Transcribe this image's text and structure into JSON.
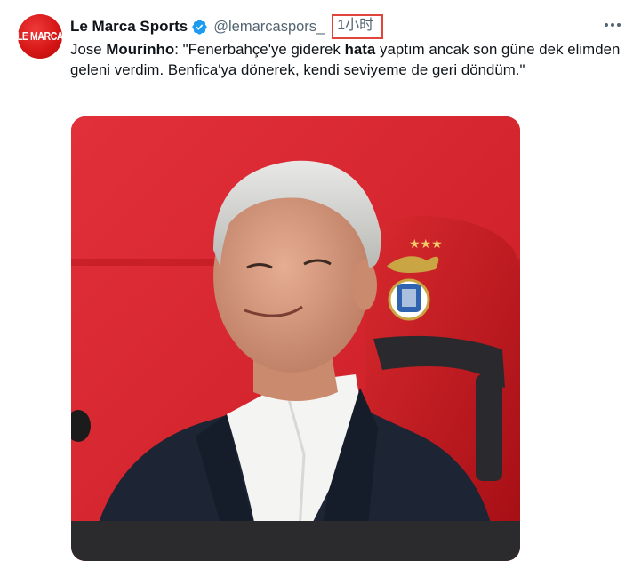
{
  "account": {
    "avatar_text": "LE MARCA",
    "display_name": "Le Marca Sports",
    "handle": "@lemarcaspors_",
    "time": "1小时",
    "verified_icon": "verified-badge-icon"
  },
  "tweet": {
    "text_parts": [
      {
        "text": "Jose ",
        "bold": false
      },
      {
        "text": "Mourinho",
        "bold": true
      },
      {
        "text": ": \"Fenerbahçe'ye giderek ",
        "bold": false
      },
      {
        "text": "hata",
        "bold": true
      },
      {
        "text": " yaptım ancak son güne dek elimden geleni verdim. Benfica'ya dönerek, kendi seviyeme de geri döndüm.\"",
        "bold": false
      }
    ]
  },
  "media": {
    "emblem_stars": "★★★",
    "colors": {
      "backdrop": "#d7262f",
      "chair": "#c8151c",
      "suit": "#1d2534",
      "shirt": "#f4f4f2",
      "hair": "#d9d9d6",
      "skin": "#d99b7f"
    }
  },
  "icons": {
    "more": "more-options-icon"
  },
  "colors": {
    "text": "#0f1419",
    "secondary": "#536471",
    "verified": "#1d9bf0",
    "highlight_box": "#e0453c"
  }
}
